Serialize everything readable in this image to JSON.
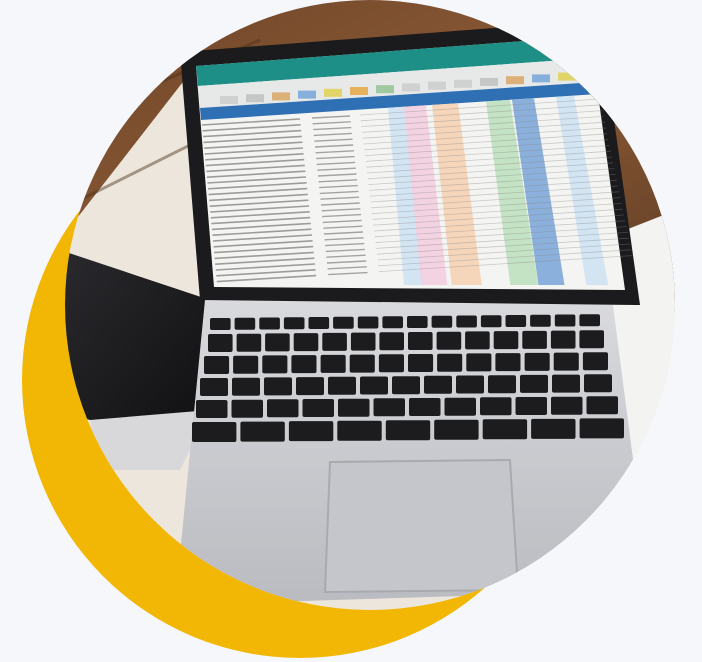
{
  "scene": {
    "subject": "laptop-with-spreadsheet",
    "colors": {
      "page_background": "#f5f7fb",
      "crescent_accent": "#f2b705",
      "photo_circle_background": "#ece6dc",
      "wood_table": "#7a4d2e",
      "laptop_body": "#cfd0d4",
      "screen_bezel": "#1b1b1d",
      "spreadsheet_header_bar": "#1d8f86",
      "keyboard_keys": "#1c1c1e"
    }
  }
}
